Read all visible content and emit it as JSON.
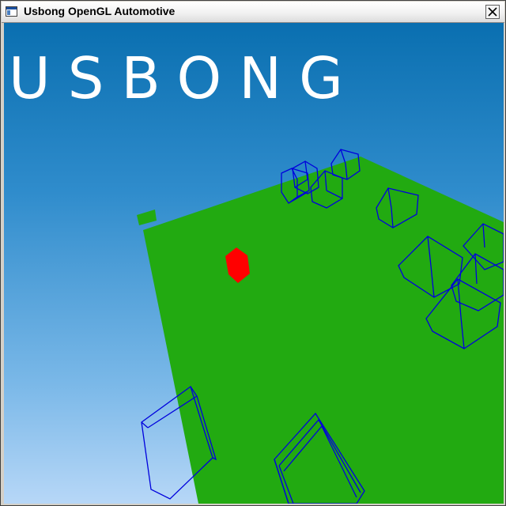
{
  "window": {
    "title": "Usbong OpenGL Automotive",
    "close_glyph": "close-icon"
  },
  "scene": {
    "logo_text": "USBONG",
    "colors": {
      "sky_top": "#0a6fb0",
      "sky_bottom": "#b7d7f7",
      "ground": "#22aa11",
      "player_cube": "#ff0000",
      "wireframe": "#0000dd",
      "logo": "#ffffff"
    }
  }
}
